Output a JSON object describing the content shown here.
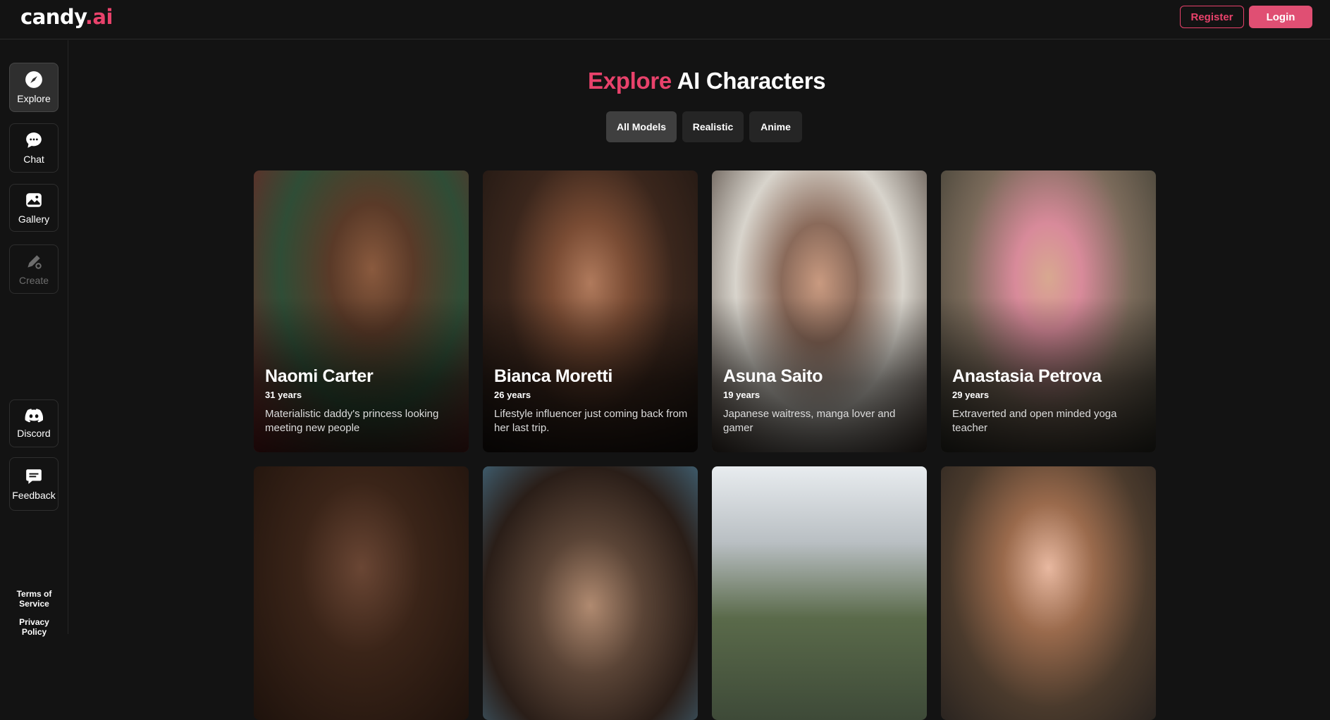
{
  "header": {
    "logo_main": "candy",
    "logo_dot": ".ai",
    "register_label": "Register",
    "login_label": "Login"
  },
  "sidebar": {
    "items": [
      {
        "label": "Explore",
        "icon": "compass-icon"
      },
      {
        "label": "Chat",
        "icon": "chat-bubble-icon"
      },
      {
        "label": "Gallery",
        "icon": "gallery-icon"
      },
      {
        "label": "Create",
        "icon": "create-brush-icon"
      },
      {
        "label": "Discord",
        "icon": "discord-icon"
      },
      {
        "label": "Feedback",
        "icon": "feedback-icon"
      }
    ],
    "terms_line1": "Terms of",
    "terms_line2": "Service",
    "privacy_line1": "Privacy",
    "privacy_line2": "Policy"
  },
  "main": {
    "title_highlight": "Explore",
    "title_rest": "AI Characters",
    "filters": [
      "All Models",
      "Realistic",
      "Anime"
    ],
    "characters": [
      {
        "name": "Naomi Carter",
        "age": "31 years",
        "description": "Materialistic daddy's princess looking meeting new people"
      },
      {
        "name": "Bianca Moretti",
        "age": "26 years",
        "description": "Lifestyle influencer just coming back from her last trip."
      },
      {
        "name": "Asuna Saito",
        "age": "19 years",
        "description": "Japanese waitress, manga lover and gamer"
      },
      {
        "name": "Anastasia Petrova",
        "age": "29 years",
        "description": "Extraverted and open minded yoga teacher"
      }
    ]
  },
  "colors": {
    "accent": "#e8426b",
    "background": "#131313"
  }
}
